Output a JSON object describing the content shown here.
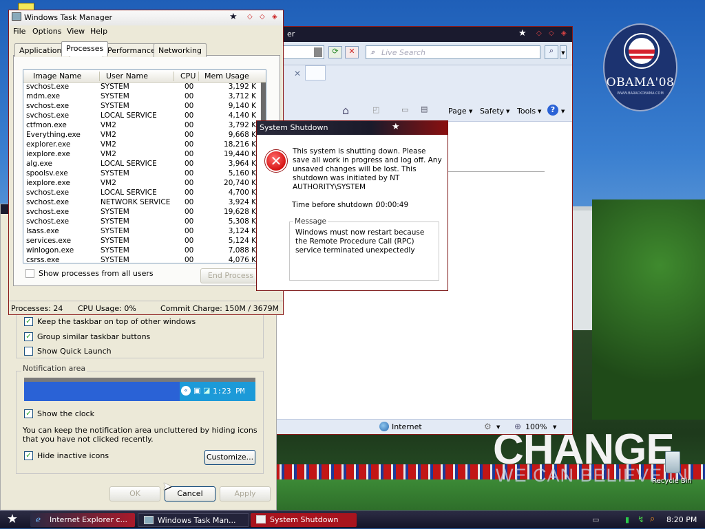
{
  "desktop": {
    "logo": {
      "name": "OBAMA'08",
      "sub": "WWW.BARACKOBAMA.COM"
    },
    "slogan": "CHANGE",
    "slogan_sub": "WE CAN BELIEVE IN",
    "recycle_bin": "Recycle Bin"
  },
  "ie": {
    "title_suffix": "er",
    "search_placeholder": "Live Search",
    "commands": {
      "page": "Page",
      "safety": "Safety",
      "tools": "Tools"
    },
    "status_zone": "Internet",
    "zoom": "100%"
  },
  "taskbar_props": {
    "options": [
      {
        "label": "Keep the taskbar on top of other windows",
        "checked": true
      },
      {
        "label": "Group similar taskbar buttons",
        "checked": true
      },
      {
        "label": "Show Quick Launch",
        "checked": false
      }
    ],
    "notification_legend": "Notification area",
    "tray_time": "1:23 PM",
    "show_clock": {
      "label": "Show the clock",
      "checked": true
    },
    "description": "You can keep the notification area uncluttered by hiding icons that you have not clicked recently.",
    "hide_inactive": {
      "label": "Hide inactive icons",
      "checked": true
    },
    "customize": "Customize...",
    "ok": "OK",
    "cancel": "Cancel",
    "apply": "Apply"
  },
  "taskmgr": {
    "title": "Windows Task Manager",
    "menu": [
      "File",
      "Options",
      "View",
      "Help"
    ],
    "tabs": [
      "Applications",
      "Processes",
      "Performance",
      "Networking"
    ],
    "active_tab": "Processes",
    "columns": [
      "Image Name",
      "User Name",
      "CPU",
      "Mem Usage"
    ],
    "rows": [
      [
        "svchost.exe",
        "SYSTEM",
        "00",
        "3,192 K"
      ],
      [
        "mdm.exe",
        "SYSTEM",
        "00",
        "3,712 K"
      ],
      [
        "svchost.exe",
        "SYSTEM",
        "00",
        "9,140 K"
      ],
      [
        "svchost.exe",
        "LOCAL SERVICE",
        "00",
        "4,140 K"
      ],
      [
        "ctfmon.exe",
        "VM2",
        "00",
        "3,792 K"
      ],
      [
        "Everything.exe",
        "VM2",
        "00",
        "9,668 K"
      ],
      [
        "explorer.exe",
        "VM2",
        "00",
        "18,216 K"
      ],
      [
        "iexplore.exe",
        "VM2",
        "00",
        "19,440 K"
      ],
      [
        "alg.exe",
        "LOCAL SERVICE",
        "00",
        "3,964 K"
      ],
      [
        "spoolsv.exe",
        "SYSTEM",
        "00",
        "5,160 K"
      ],
      [
        "iexplore.exe",
        "VM2",
        "00",
        "20,740 K"
      ],
      [
        "svchost.exe",
        "LOCAL SERVICE",
        "00",
        "4,700 K"
      ],
      [
        "svchost.exe",
        "NETWORK SERVICE",
        "00",
        "3,924 K"
      ],
      [
        "svchost.exe",
        "SYSTEM",
        "00",
        "19,628 K"
      ],
      [
        "svchost.exe",
        "SYSTEM",
        "00",
        "5,308 K"
      ],
      [
        "lsass.exe",
        "SYSTEM",
        "00",
        "3,124 K"
      ],
      [
        "services.exe",
        "SYSTEM",
        "00",
        "5,124 K"
      ],
      [
        "winlogon.exe",
        "SYSTEM",
        "00",
        "7,088 K"
      ],
      [
        "csrss.exe",
        "SYSTEM",
        "00",
        "4,076 K"
      ]
    ],
    "show_all_label": "Show processes from all users",
    "end_process": "End Process",
    "status": {
      "processes": "Processes: 24",
      "cpu": "CPU Usage: 0%",
      "commit": "Commit Charge: 150M / 3679M"
    }
  },
  "shutdown": {
    "title": "System Shutdown",
    "message": "This system is shutting down. Please save all work in progress and log off. Any unsaved changes will be lost. This shutdown was initiated by NT AUTHORITY\\SYSTEM",
    "time_label": "Time before shutdown :",
    "time_value": "00:00:49",
    "group_label": "Message",
    "group_text": "Windows must now restart because the Remote Procedure Call (RPC) service terminated unexpectedly"
  },
  "taskbar": {
    "tasks": [
      "Internet Explorer c...",
      "Windows Task Man...",
      "System Shutdown"
    ],
    "clock": "8:20 PM"
  },
  "colors": {
    "accent_red": "#c21616",
    "taskbar": "#141428",
    "selection_blue": "#2a62d6"
  }
}
